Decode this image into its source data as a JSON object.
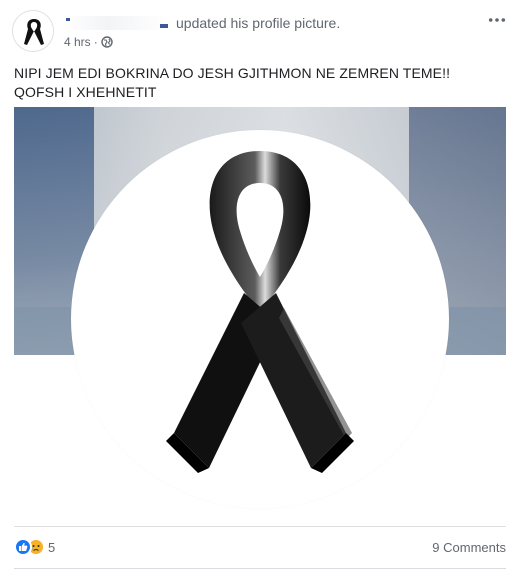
{
  "post": {
    "author_name": "",
    "action_text": "updated his profile picture.",
    "timestamp": "4 hrs",
    "separator": "·",
    "privacy_icon": "globe-icon",
    "more_icon": "more-horizontal-icon",
    "body_text": "NIPI JEM EDI BOKRINA DO JESH GJITHMON NE ZEMREN TEME!! QOFSH I XHEHNETIT",
    "media": {
      "profile_picture_icon": "black-ribbon-icon",
      "cover_description_icon": "cover-photo"
    }
  },
  "stats": {
    "reaction_icons": [
      "like-icon",
      "sad-icon"
    ],
    "reaction_count": "5",
    "comments_label": "9 Comments"
  },
  "colors": {
    "like_blue": "#1877f2",
    "sad_yellow": "#f7b125",
    "meta_gray": "#616770",
    "text_dark": "#1c1e21"
  }
}
